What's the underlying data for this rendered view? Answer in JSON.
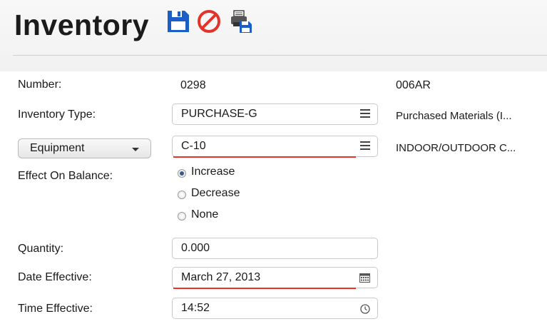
{
  "header": {
    "title": "Inventory",
    "save_icon": "floppy-disk-icon",
    "cancel_icon": "prohibited-icon",
    "save_print_icon": "print-save-icon"
  },
  "colors": {
    "save_blue": "#1a5ec6",
    "cancel_red": "#e0342a",
    "required_underline": "#e5332a"
  },
  "form": {
    "number_label": "Number:",
    "number_value": "0298",
    "number_code": "006AR",
    "inventory_type_label": "Inventory Type:",
    "inventory_type_value": "PURCHASE-G",
    "inventory_type_desc": "Purchased Materials (I...",
    "category_dropdown": "Equipment",
    "category_value": "C-10",
    "category_desc": "INDOOR/OUTDOOR C...",
    "effect_label": "Effect On Balance:",
    "effect_options": [
      "Increase",
      "Decrease",
      "None"
    ],
    "effect_selected": "Increase",
    "quantity_label": "Quantity:",
    "quantity_value": "0.000",
    "date_label": "Date Effective:",
    "date_value": "March 27, 2013",
    "time_label": "Time Effective:",
    "time_value": "14:52"
  }
}
